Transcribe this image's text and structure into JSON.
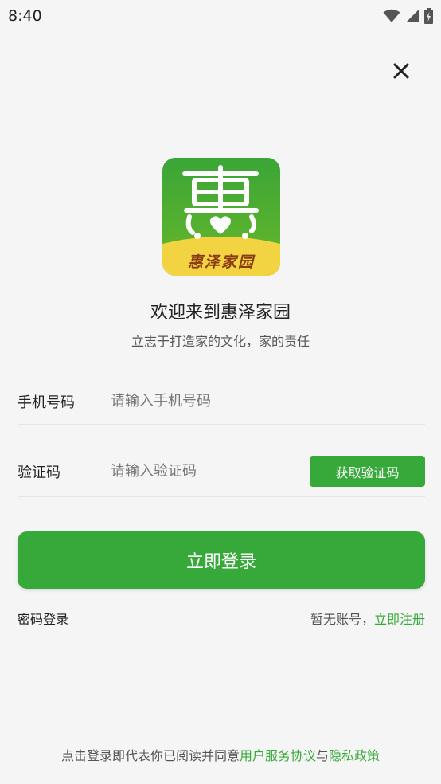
{
  "status_bar": {
    "time": "8:40",
    "icons": [
      "wifi-icon",
      "cell-signal-icon",
      "battery-charging-icon"
    ]
  },
  "close": {
    "icon": "close-icon"
  },
  "logo": {
    "icon": "logo-hui-icon",
    "text": "惠泽家园",
    "colors": {
      "green": "#3aa537",
      "yellow": "#f2d443"
    }
  },
  "welcome": {
    "title": "欢迎来到惠泽家园",
    "subtitle": "立志于打造家的文化，家的责任"
  },
  "form": {
    "phone": {
      "label": "手机号码",
      "placeholder": "请输入手机号码",
      "value": ""
    },
    "code": {
      "label": "验证码",
      "placeholder": "请输入验证码",
      "value": "",
      "button": "获取验证码"
    }
  },
  "login_button": "立即登录",
  "links": {
    "password_login": "密码登录",
    "no_account": "暂无账号，",
    "register": "立即注册"
  },
  "agreement": {
    "prefix": "点击登录即代表你已阅读并同意",
    "user_agreement": "用户服务协议",
    "and": "与",
    "privacy": "隐私政策"
  },
  "colors": {
    "accent": "#37a93a",
    "background": "#f5f5f5"
  }
}
